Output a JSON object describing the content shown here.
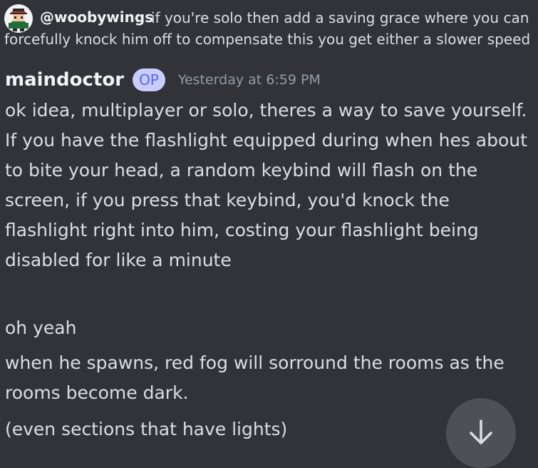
{
  "reply": {
    "handle": "@woobywings",
    "text": "if you're solo then add a saving grace where you can forcefully knock him off to compensate this you get either a slower speed",
    "avatar_icon": "pixel-character-avatar-icon"
  },
  "message": {
    "author": "maindoctor",
    "badge": "OP",
    "timestamp": "Yesterday at 6:59 PM",
    "paragraphs": [
      "ok idea, multiplayer or solo, theres a way to save yourself.",
      "If you have the flashlight equipped during when hes about to bite your head, a random keybind will flash on the screen, if you press that keybind, you'd knock the flashlight right into him, costing your flashlight being disabled for like a minute"
    ]
  },
  "followups": [
    "oh yeah",
    "when he spawns, red fog will sorround the rooms as the rooms  become dark.",
    "(even sections that have lights)"
  ],
  "colors": {
    "background": "#313338",
    "text": "#dbdee1",
    "muted": "#949ba4",
    "badge_bg": "#c9cdfb",
    "badge_text": "#5865f2",
    "scroll_button": "#4e5058"
  },
  "scroll_button_icon": "arrow-down-icon"
}
